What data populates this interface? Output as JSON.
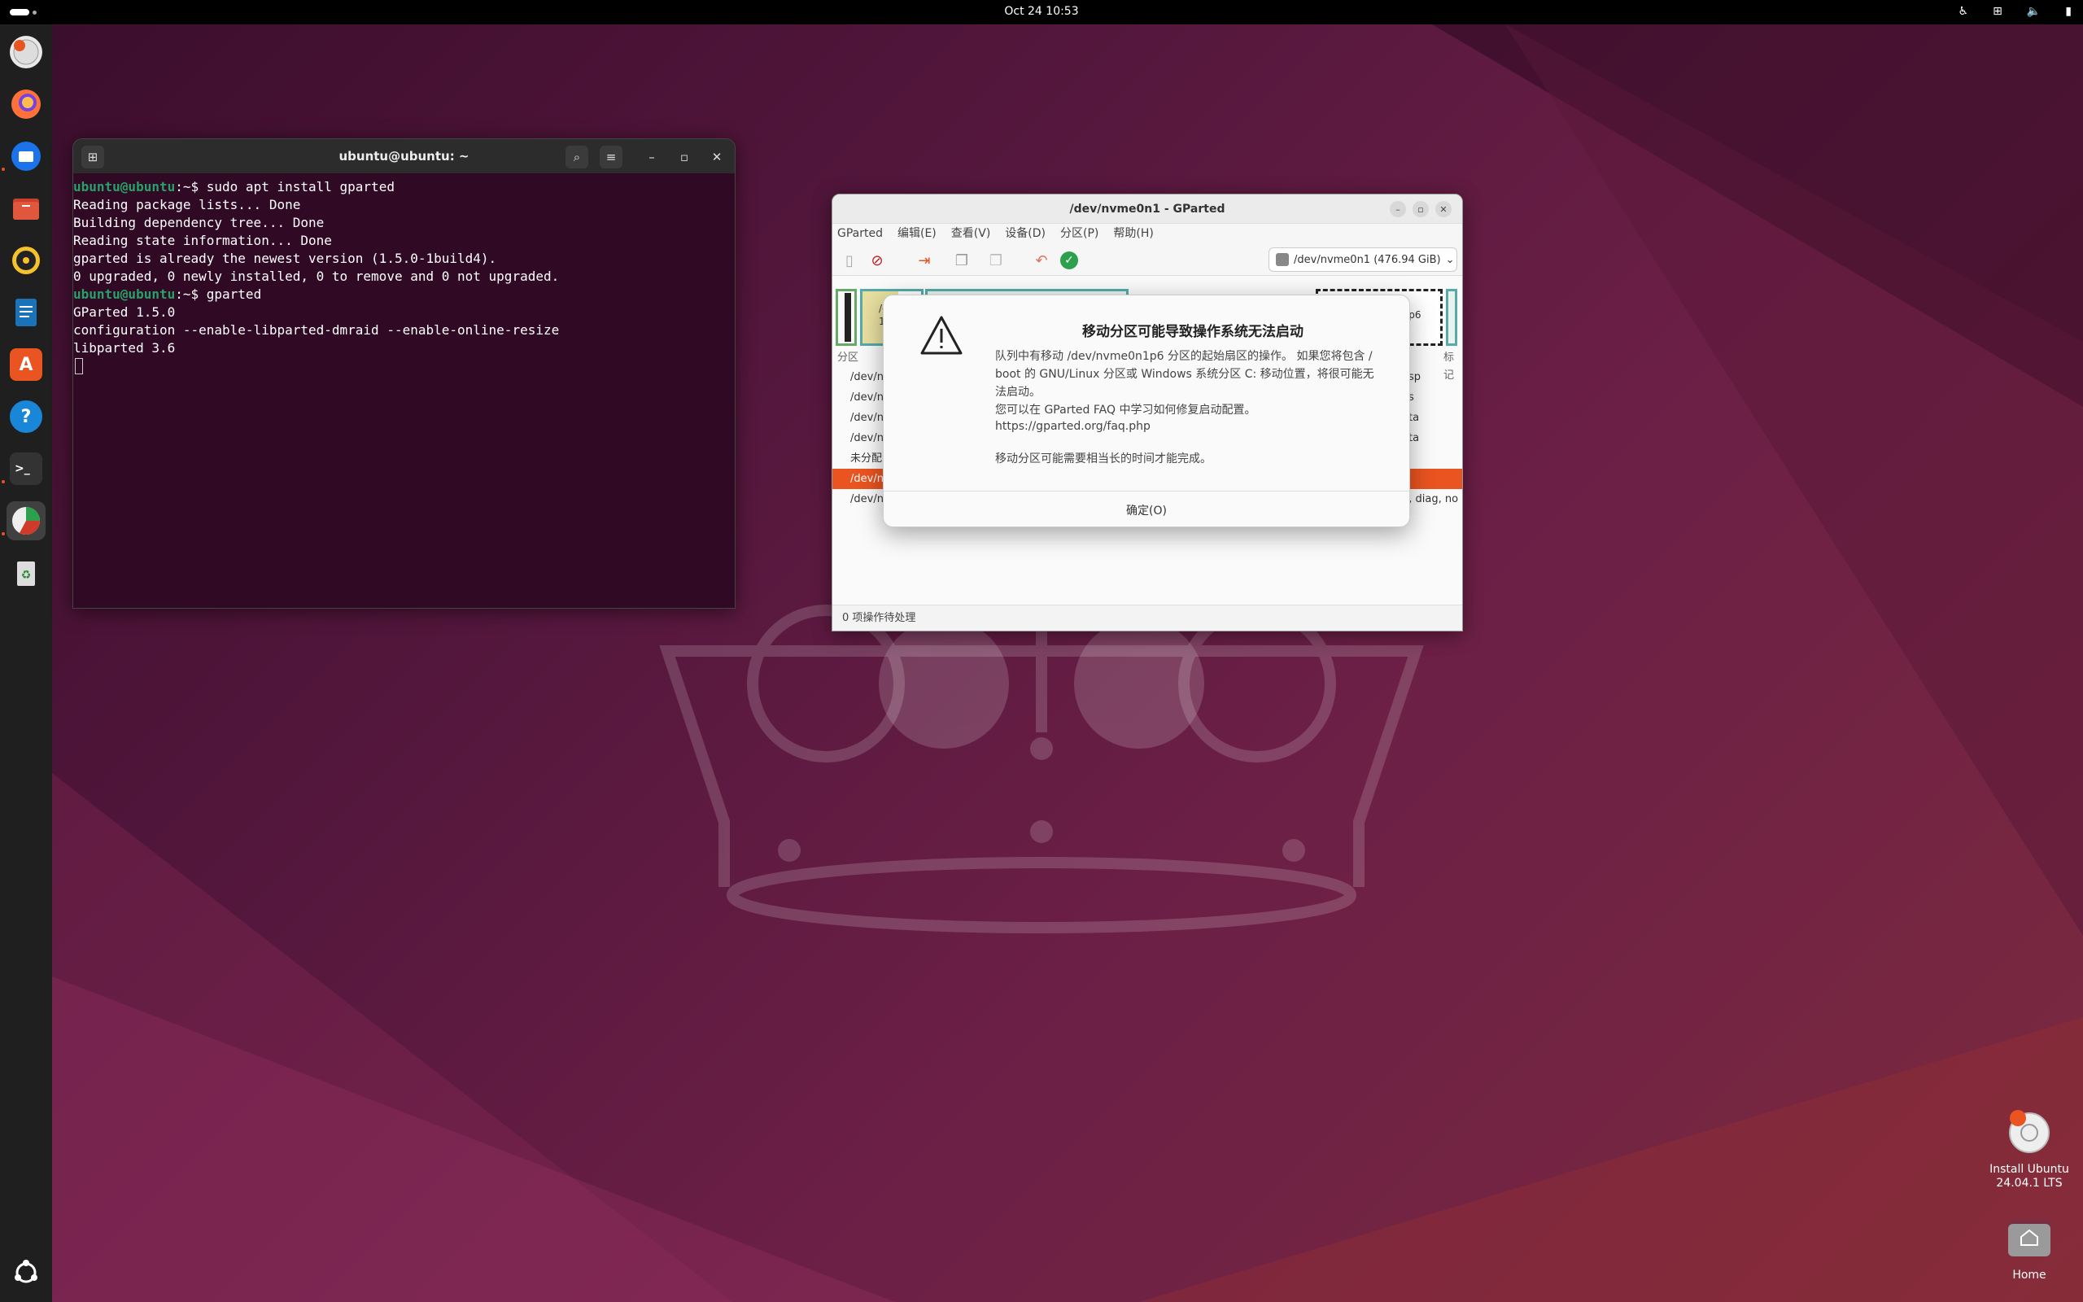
{
  "topbar": {
    "clock": "Oct 24  10:53",
    "tray_icons": [
      "accessibility-icon",
      "network-icon",
      "volume-icon",
      "battery-icon"
    ]
  },
  "dock": {
    "items": [
      {
        "name": "ubuntu-installer-icon",
        "color": "#e95420"
      },
      {
        "name": "firefox-icon",
        "color": "#ff7139"
      },
      {
        "name": "thunderbird-icon",
        "color": "#1a73e8"
      },
      {
        "name": "files-icon",
        "color": "#c9412b"
      },
      {
        "name": "rhythmbox-icon",
        "color": "#f4c32c"
      },
      {
        "name": "libreoffice-writer-icon",
        "color": "#1a73b8"
      },
      {
        "name": "app-center-icon",
        "color": "#e95420"
      },
      {
        "name": "help-icon",
        "color": "#1a86d8"
      },
      {
        "name": "terminal-icon",
        "color": "#333333"
      },
      {
        "name": "gparted-icon",
        "color": "#2ca04c"
      },
      {
        "name": "trash-icon",
        "color": "#888888"
      }
    ],
    "apps_grid_icon": "show-apps-icon"
  },
  "terminal": {
    "title": "ubuntu@ubuntu: ~",
    "prompt_user": "ubuntu@ubuntu",
    "prompt_path": ":~$ ",
    "lines": [
      {
        "type": "prompt",
        "cmd": "sudo apt install gparted"
      },
      {
        "type": "out",
        "text": "Reading package lists... Done"
      },
      {
        "type": "out",
        "text": "Building dependency tree... Done"
      },
      {
        "type": "out",
        "text": "Reading state information... Done"
      },
      {
        "type": "out",
        "text": "gparted is already the newest version (1.5.0-1build4)."
      },
      {
        "type": "out",
        "text": "0 upgraded, 0 newly installed, 0 to remove and 0 not upgraded."
      },
      {
        "type": "prompt",
        "cmd": "gparted"
      },
      {
        "type": "out",
        "text": "GParted 1.5.0"
      },
      {
        "type": "out",
        "text": "configuration --enable-libparted-dmraid --enable-online-resize"
      },
      {
        "type": "out",
        "text": "libparted 3.6"
      }
    ]
  },
  "gparted": {
    "title": "/dev/nvme0n1 - GParted",
    "menu": [
      "GParted",
      "编辑(E)",
      "查看(V)",
      "设备(D)",
      "分区(P)",
      "帮助(H)"
    ],
    "device_selector": "/dev/nvme0n1 (476.94 GiB)",
    "graph_labels": {
      "left": "/c",
      "left2": "1(",
      "right": "n1p6"
    },
    "list_header_left": "分区",
    "list_header_right": "标记",
    "rows": [
      {
        "left": "/dev/n",
        "right": "esp",
        "selected": false
      },
      {
        "left": "/dev/n",
        "right": "es",
        "selected": false
      },
      {
        "left": "/dev/n",
        "right": "ata",
        "selected": false
      },
      {
        "left": "/dev/n",
        "right": "ata",
        "selected": false
      },
      {
        "left": "未分配",
        "right": "",
        "selected": false
      },
      {
        "left": "/dev/n",
        "right": "",
        "selected": true
      },
      {
        "left": "/dev/n",
        "right": "n, diag, no",
        "selected": false
      }
    ],
    "status": "0 项操作待处理"
  },
  "dialog": {
    "title": "移动分区可能导致操作系统无法启动",
    "line1": "队列中有移动 /dev/nvme0n1p6 分区的起始扇区的操作。 如果您将包含 /",
    "line2": "boot 的 GNU/Linux 分区或 Windows 系统分区 C: 移动位置，将很可能无",
    "line3": "法启动。",
    "line4": "您可以在 GParted FAQ 中学习如何修复启动配置。",
    "url": "https://gparted.org/faq.php",
    "line5": "移动分区可能需要相当长的时间才能完成。",
    "ok": "确定(O)"
  },
  "desktop": {
    "install": {
      "line1": "Install Ubuntu",
      "line2": "24.04.1 LTS"
    },
    "home": "Home"
  }
}
